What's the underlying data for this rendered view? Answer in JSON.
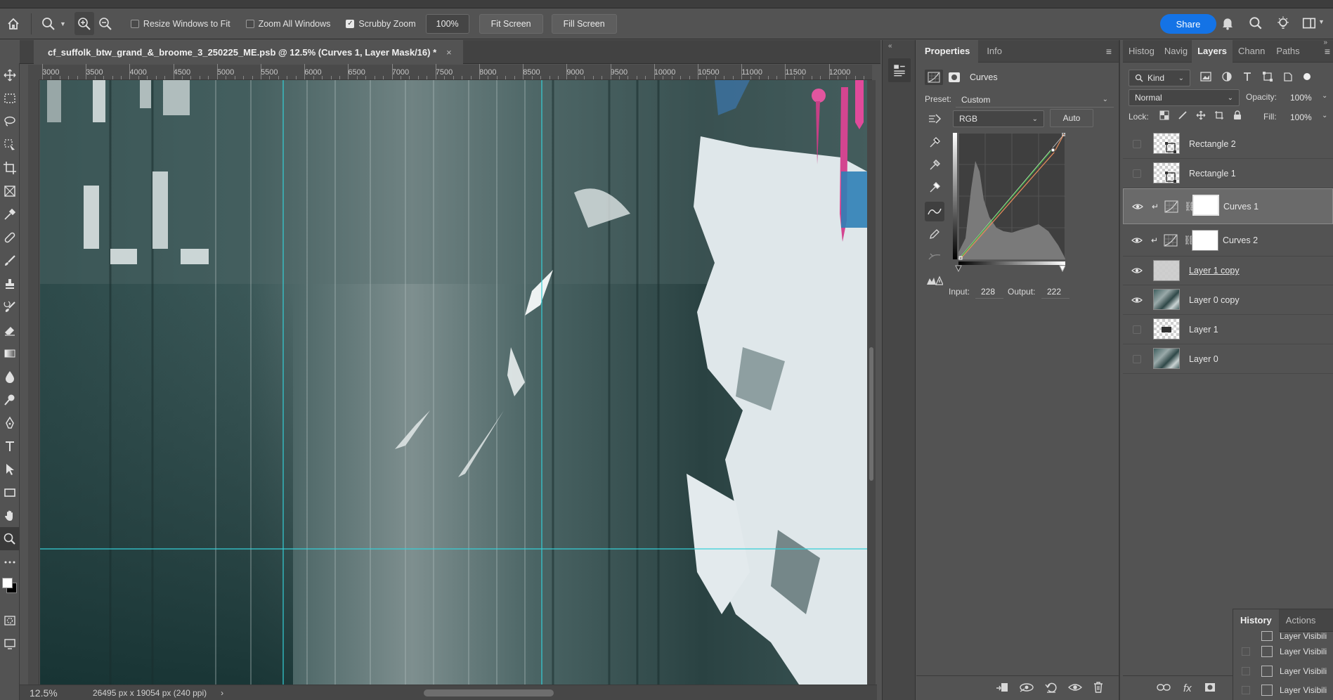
{
  "options_bar": {
    "resize_windows_label": "Resize Windows to Fit",
    "zoom_all_label": "Zoom All Windows",
    "scrubby_label": "Scrubby Zoom",
    "zoom_value": "100%",
    "fit_screen_label": "Fit Screen",
    "fill_screen_label": "Fill Screen",
    "share_label": "Share"
  },
  "document": {
    "tab_title": "cf_suffolk_btw_grand_&_broome_3_250225_ME.psb @ 12.5% (Curves 1, Layer Mask/16) *",
    "close_glyph": "×",
    "ruler_labels": [
      "3000",
      "3500",
      "4000",
      "4500",
      "5000",
      "5500",
      "6000",
      "6500",
      "7000",
      "7500",
      "8000",
      "8500",
      "9000",
      "9500",
      "10000",
      "10500",
      "11000",
      "11500",
      "12000"
    ]
  },
  "status": {
    "zoom": "12.5%",
    "dimensions": "26495 px x 19054 px (240 ppi)",
    "arrow": "›"
  },
  "properties": {
    "tabs": [
      "Properties",
      "Info"
    ],
    "adjustment_label": "Curves",
    "preset_label": "Preset:",
    "preset_value": "Custom",
    "channel_value": "RGB",
    "auto_label": "Auto",
    "input_label": "Input:",
    "input_value": "228",
    "output_label": "Output:",
    "output_value": "222"
  },
  "layers_panel": {
    "tabs": [
      "Histog",
      "Navig",
      "Layers",
      "Chann",
      "Paths"
    ],
    "filter_label": "Kind",
    "blend_mode": "Normal",
    "opacity_label": "Opacity:",
    "opacity_value": "100%",
    "lock_label": "Lock:",
    "fill_label": "Fill:",
    "fill_value": "100%",
    "layers": [
      {
        "name": "Rectangle 2",
        "visible": false
      },
      {
        "name": "Rectangle 1",
        "visible": false
      },
      {
        "name": "Curves 1",
        "visible": true,
        "selected": true
      },
      {
        "name": "Curves 2",
        "visible": true
      },
      {
        "name": "Layer 1 copy",
        "visible": true
      },
      {
        "name": "Layer 0 copy",
        "visible": true
      },
      {
        "name": "Layer 1",
        "visible": false
      },
      {
        "name": "Layer 0",
        "visible": false
      }
    ]
  },
  "history": {
    "tabs": [
      "History",
      "Actions"
    ],
    "items": [
      "Layer Visibili",
      "Layer Visibili",
      "Layer Visibili",
      "Layer Visibili"
    ]
  },
  "colors": {
    "accent": "#1473e6",
    "guide": "#35d0d8",
    "panel_bg": "#535353"
  }
}
